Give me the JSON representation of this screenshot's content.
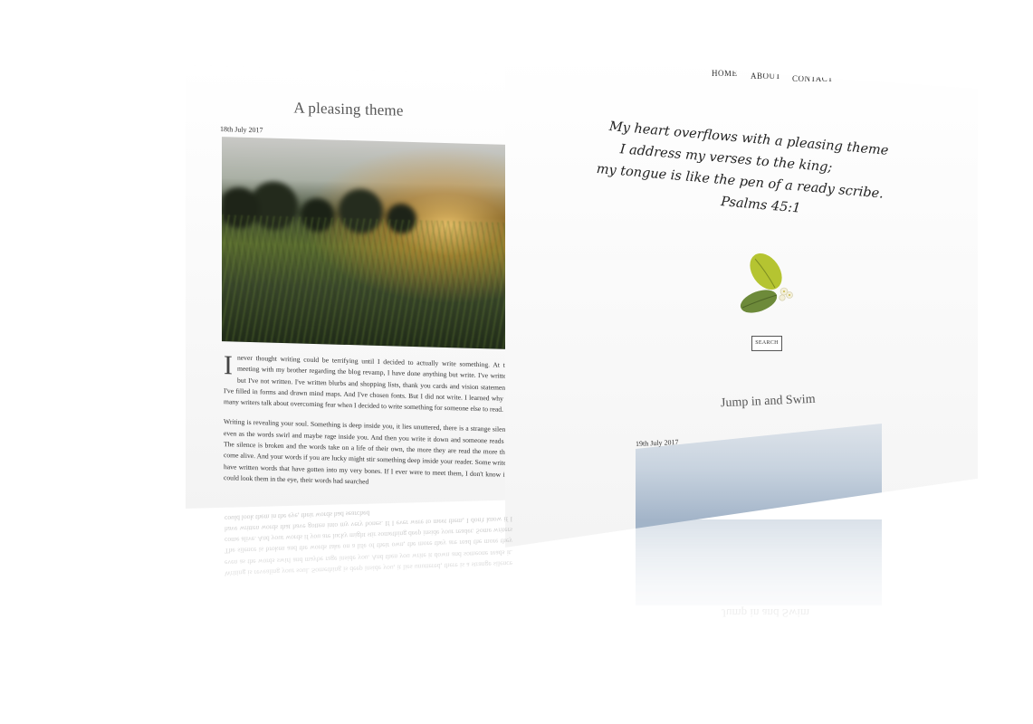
{
  "left_page": {
    "post_title": "A pleasing theme",
    "post_date": "18th July 2017",
    "dropcap": "I",
    "paragraph1": "never thought writing could be terrifying until I decided to actually write something. At the meeting with my brother regarding the blog revamp, I have done anything but write. I've written, but I've not written. I've written blurbs and shopping lists, thank you cards and vision statements, I've filled in forms and drawn mind maps. And I've chosen fonts. But I did not write. I learned why so many writers talk about overcoming fear when I decided to write something for someone else to read.",
    "paragraph2": "Writing is revealing your soul. Something is deep inside you, it lies unuttered, there is a strange silence even as the words swirl and maybe rage inside you. And then you write it down and someone reads it. The silence is broken and the words take on a life of their own, the more they are read the more they come alive. And your words if you are lucky might stir something deep inside your reader. Some writers have written words that have gotten into my very bones. If I ever were to meet them, I don't know if I could look them in the eye, their words had searched"
  },
  "right_page": {
    "nav": [
      "HOME",
      "ABOUT",
      "CONTACT"
    ],
    "quote_lines": [
      "My heart overflows with a pleasing theme",
      "I address my verses to the king;",
      "my tongue is like the pen of a ready scribe."
    ],
    "quote_ref": "Psalms 45:1",
    "search_label": "SEARCH",
    "post_title": "Jump in and Swim",
    "post_date": "19th July 2017"
  },
  "colors": {
    "leaf_light": "#b5c431",
    "leaf_dark": "#6d8a3a",
    "text": "#333333"
  }
}
